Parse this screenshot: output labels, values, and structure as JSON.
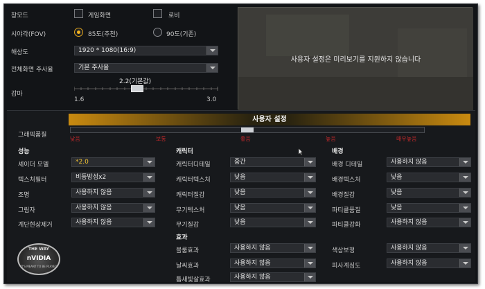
{
  "top": {
    "window_mode": {
      "label": "창모드",
      "game_screen": "게임화면",
      "lobby": "로비"
    },
    "fov": {
      "label": "시야각(FOV)",
      "opt1": "85도(추천)",
      "opt2": "90도(기존)",
      "selected": "85도(추천)"
    },
    "resolution": {
      "label": "해상도",
      "value": "1920 * 1080(16:9)"
    },
    "refresh": {
      "label": "전체화면 주사율",
      "value": "기본 주사율"
    },
    "gamma": {
      "label": "감마",
      "current": "2.2(기본값)",
      "min": "1.6",
      "max": "3.0",
      "value": 2.2
    }
  },
  "preview": {
    "text": "사용자 설정은 미리보기를 지원하지 않습니다"
  },
  "custom": {
    "title": "사용자 설정",
    "quality_label": "그래픽품질",
    "levels": [
      "낮음",
      "보통",
      "좋음",
      "높음",
      "매우높음"
    ],
    "quality_position": 0.5
  },
  "performance": {
    "title": "성능",
    "rows": [
      {
        "label": "셰이더 모델",
        "value": "*2.0",
        "highlight": true
      },
      {
        "label": "텍스처필터",
        "value": "비등방성x2"
      },
      {
        "label": "조명",
        "value": "사용하지 않음"
      },
      {
        "label": "그림자",
        "value": "사용하지 않음"
      },
      {
        "label": "계단현상제거",
        "value": "사용하지 않음"
      }
    ]
  },
  "character": {
    "title": "캐릭터",
    "rows": [
      {
        "label": "캐릭터디테일",
        "value": "중간"
      },
      {
        "label": "캐릭터텍스처",
        "value": "낮음"
      },
      {
        "label": "캐릭터질감",
        "value": "낮음"
      },
      {
        "label": "무기텍스처",
        "value": "낮음"
      },
      {
        "label": "무기질감",
        "value": "낮음"
      }
    ]
  },
  "background": {
    "title": "배경",
    "rows": [
      {
        "label": "배경 디테일",
        "value": "사용하지 않음"
      },
      {
        "label": "배경텍스처",
        "value": "낮음"
      },
      {
        "label": "배경질감",
        "value": "낮음"
      },
      {
        "label": "파티클품질",
        "value": "낮음"
      },
      {
        "label": "파티클강화",
        "value": "사용하지 않음"
      }
    ]
  },
  "effects": {
    "title": "효과",
    "rows": [
      {
        "label": "블룸효과",
        "value": "사용하지 않음"
      },
      {
        "label": "날씨효과",
        "value": "사용하지 않음"
      },
      {
        "label": "틈새빛살효과",
        "value": "사용하지 않음"
      }
    ],
    "rows_right": [
      {
        "label": "색상보정",
        "value": "사용하지 않음"
      },
      {
        "label": "피사계심도",
        "value": "사용하지 않음"
      }
    ]
  },
  "logo": {
    "top": "THE WAY",
    "middle": "nVIDIA",
    "bottom": "IT'S MEANT TO BE PLAYED"
  },
  "colors": {
    "accent": "#f1b21f",
    "level": "#c0282a",
    "panel": "#17191c"
  }
}
